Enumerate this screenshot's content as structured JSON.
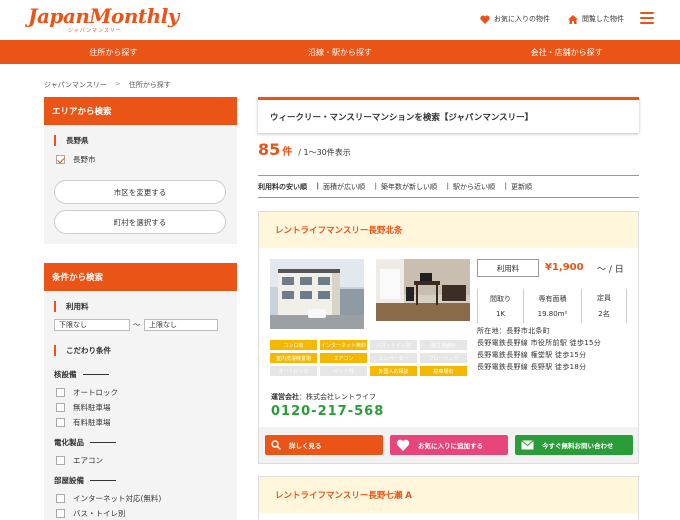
{
  "header": {
    "logo_text": "JapanMonthly",
    "logo_sub": "ジャパンマンスリー",
    "favorites_label": "お気に入りの物件",
    "viewed_label": "閲覧した物件"
  },
  "nav": {
    "items": [
      "住所から探す",
      "沿線・駅から探す",
      "会社・店舗から探す"
    ]
  },
  "breadcrumb": {
    "home": "ジャパンマンスリー",
    "separator": ">",
    "current": "住所から探す"
  },
  "area_search": {
    "title": "エリアから検索",
    "prefecture": "長野県",
    "city": "長野市",
    "change_city_button": "市区を変更する",
    "select_town_button": "町村を選択する"
  },
  "condition_search": {
    "title": "条件から検索",
    "fee_label": "利用料",
    "min_select": "下限なし",
    "range_sep": "〜",
    "max_select": "上限なし",
    "features_label": "こだわり条件",
    "groups": [
      {
        "title": "核設備",
        "items": [
          "オートロック",
          "無料駐車場",
          "有料駐車場"
        ]
      },
      {
        "title": "電化製品",
        "items": [
          "エアコン"
        ]
      },
      {
        "title": "部屋設備",
        "items": [
          "インターネット対応(無料)",
          "バス・トイレ別"
        ]
      }
    ]
  },
  "results": {
    "heading": "ウィークリー・マンスリーマンションを検索【ジャパンマンスリー】",
    "count": "85",
    "count_unit": "件",
    "range": "/ 1〜30件表示",
    "sort_options": [
      "利用料の安い順",
      "面積が広い順",
      "築年数が新しい順",
      "駅から近い順",
      "更新順"
    ]
  },
  "listings": [
    {
      "name": "レントライフマンスリー長野北条",
      "tags": [
        {
          "label": "コンロ有",
          "on": true
        },
        {
          "label": "インターネット無料",
          "on": true
        },
        {
          "label": "バス・トイレ別",
          "on": false
        },
        {
          "label": "独立洗面台",
          "on": false
        },
        {
          "label": "室内洗濯機置場",
          "on": true
        },
        {
          "label": "エアコン",
          "on": true
        },
        {
          "label": "エレベーター",
          "on": false
        },
        {
          "label": "フローリング",
          "on": false
        },
        {
          "label": "オートロック",
          "on": false
        },
        {
          "label": "ペット可",
          "on": false
        },
        {
          "label": "外国人応相談",
          "on": true
        },
        {
          "label": "駐車場有",
          "on": true
        }
      ],
      "fee_label": "利用料",
      "fee_value": "¥1,900",
      "fee_unit": "〜 / 日",
      "specs": [
        {
          "label": "間取り",
          "value": "1K"
        },
        {
          "label": "専有面積",
          "value": "19.80m²"
        },
        {
          "label": "定員",
          "value": "2名"
        }
      ],
      "address_lines": [
        "所在地：長野市北条町",
        "長野電鉄長野線 市役所前駅 徒歩15分",
        "長野電鉄長野線 権堂駅 徒歩15分",
        "長野電鉄長野線 長野駅 徒歩18分"
      ],
      "company_label": "運営会社",
      "company_name": "：株式会社レントライフ",
      "phone": "0120-217-568",
      "buttons": {
        "details": "詳しく見る",
        "favorite": "お気に入りに追加する",
        "inquiry": "今すぐ無料お問い合わせ"
      }
    },
    {
      "name": "レントライフマンスリー長野七瀬 A"
    }
  ],
  "colors": {
    "brand": "#ea5416",
    "tag_on": "#f5b800",
    "phone": "#2a9d39",
    "btn_details": "#ea5416",
    "btn_favorite": "#e8457d",
    "btn_inquiry": "#2a9d39"
  }
}
